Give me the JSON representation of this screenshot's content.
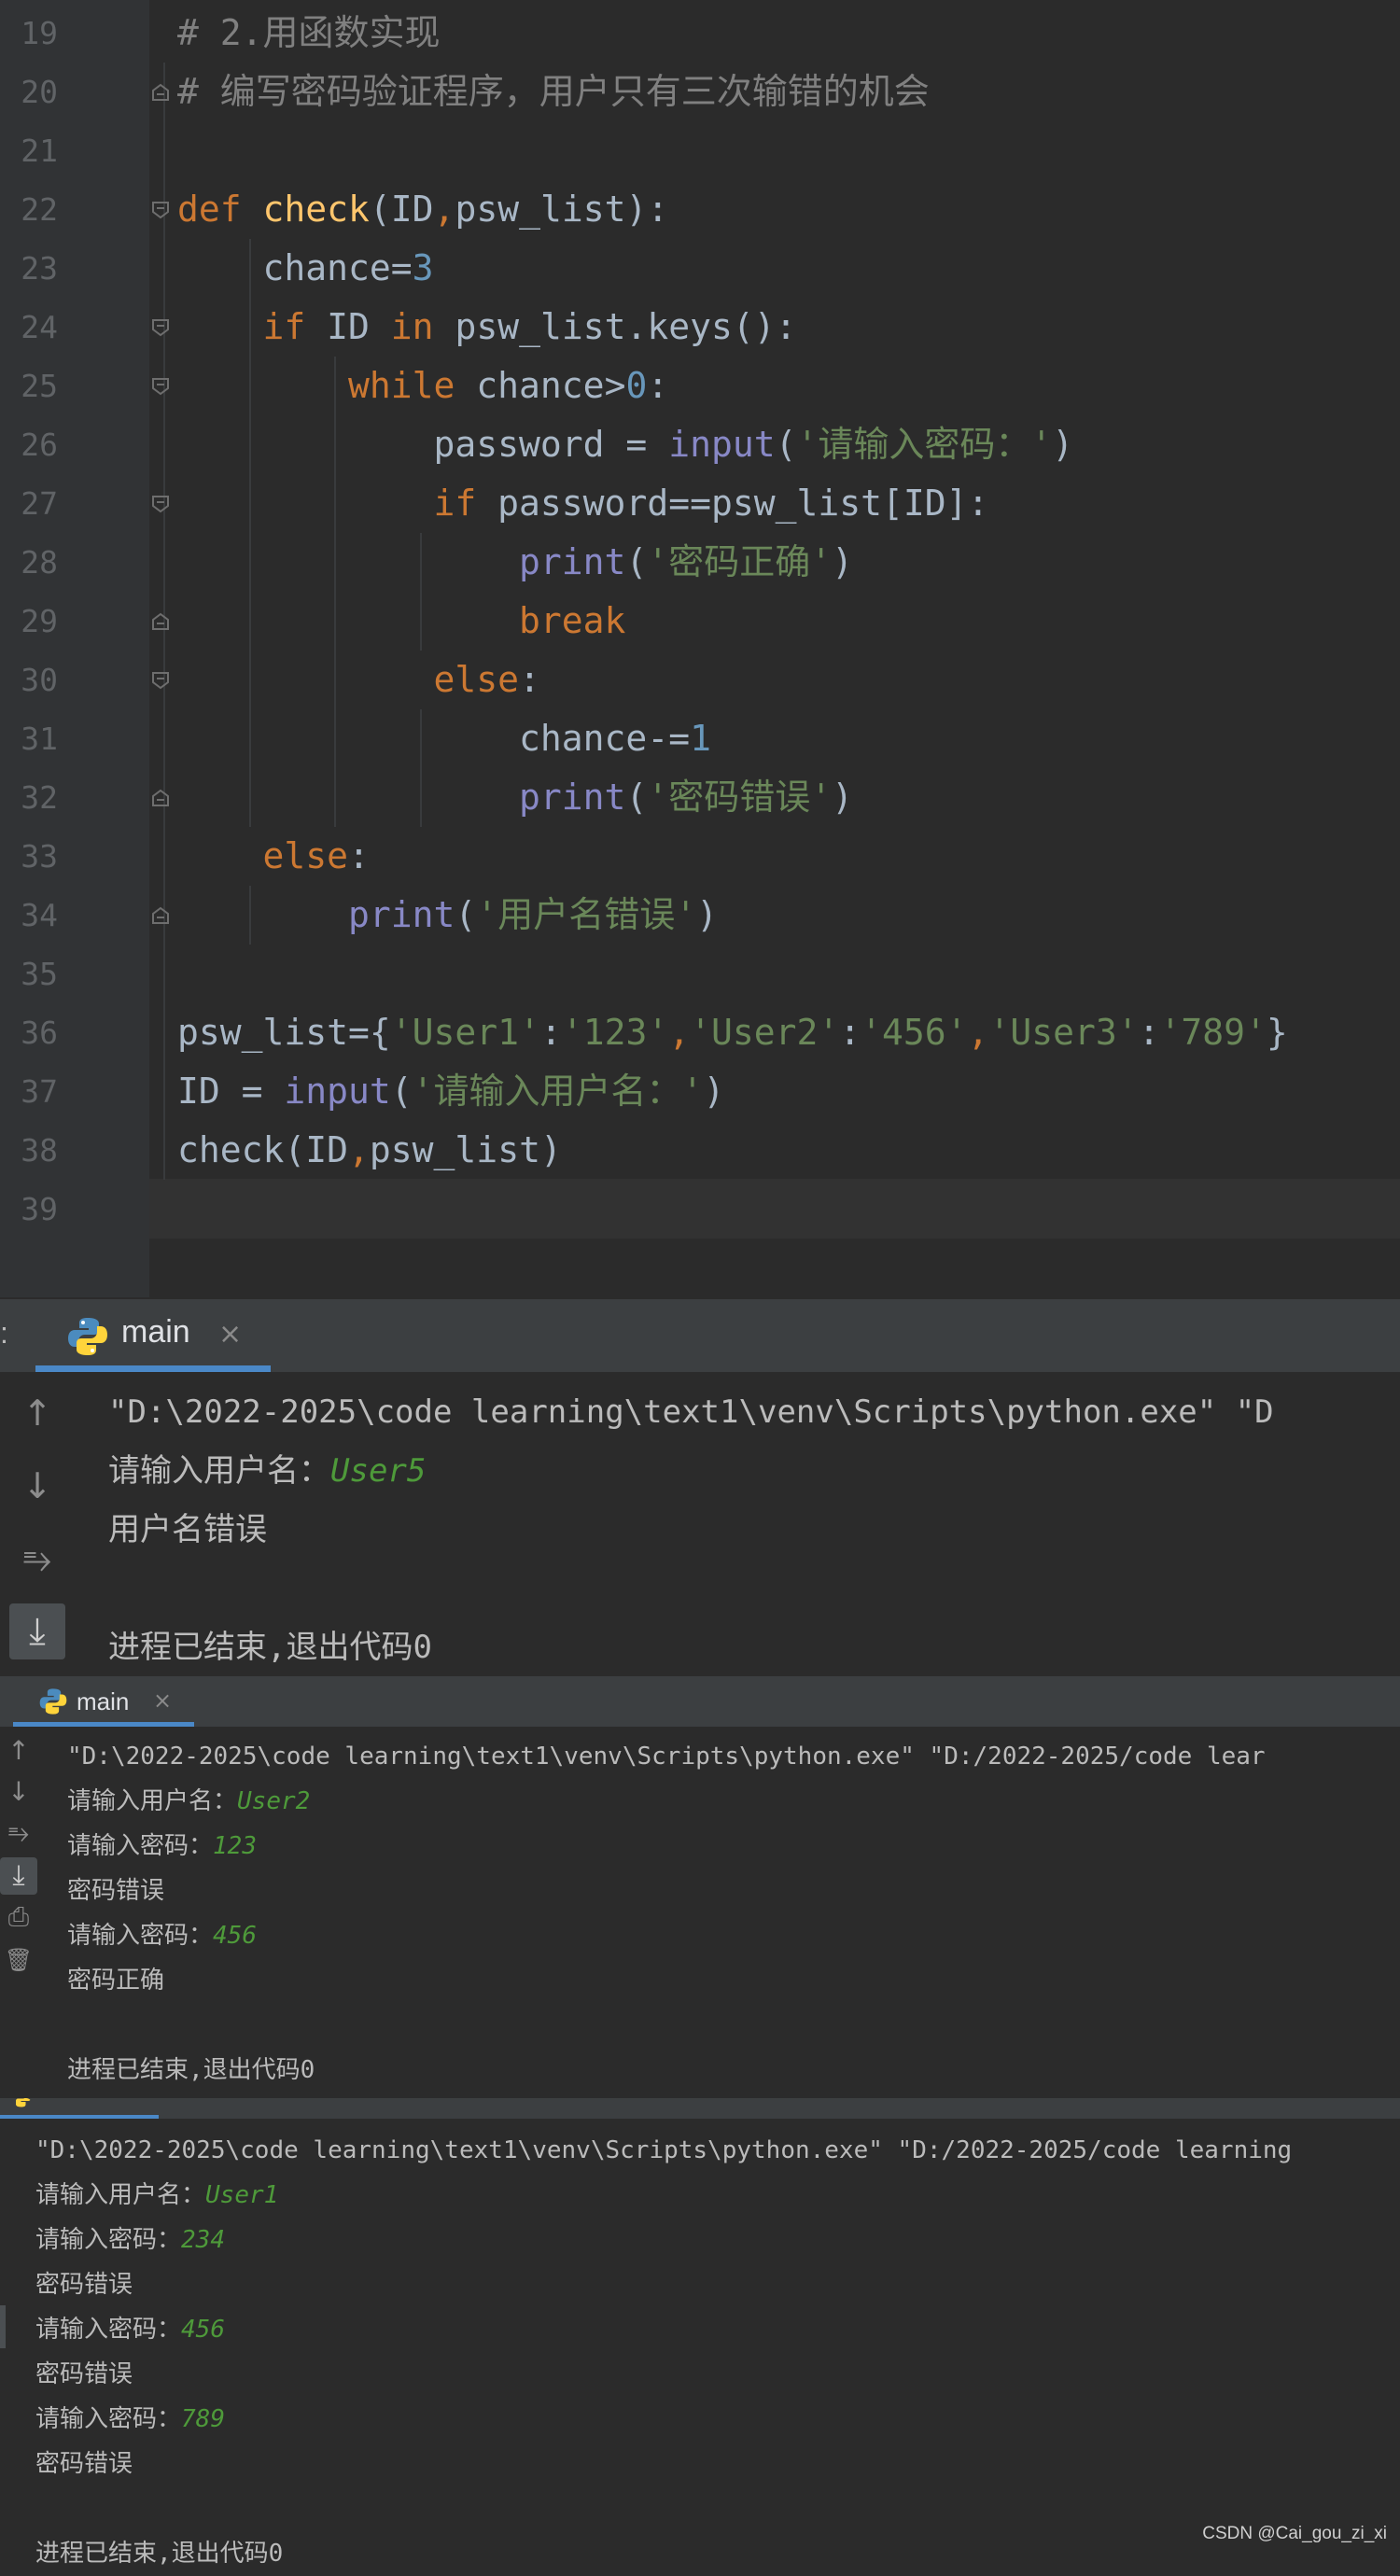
{
  "editor": {
    "lines": [
      {
        "n": "19",
        "tokens": [
          {
            "c": "cm",
            "t": "# 2.用函数实现"
          }
        ]
      },
      {
        "n": "20",
        "tokens": [
          {
            "c": "cm",
            "t": "# 编写密码验证程序，用户只有三次输错的机会"
          }
        ]
      },
      {
        "n": "21",
        "tokens": []
      },
      {
        "n": "22",
        "tokens": [
          {
            "c": "kw",
            "t": "def "
          },
          {
            "c": "fn",
            "t": "check"
          },
          {
            "c": "",
            "t": "(ID"
          },
          {
            "c": "kw",
            "t": ","
          },
          {
            "c": "",
            "t": "psw_list):"
          }
        ]
      },
      {
        "n": "23",
        "tokens": [
          {
            "c": "",
            "t": "    chance="
          },
          {
            "c": "num",
            "t": "3"
          }
        ]
      },
      {
        "n": "24",
        "tokens": [
          {
            "c": "kw",
            "t": "    if "
          },
          {
            "c": "",
            "t": "ID "
          },
          {
            "c": "kw",
            "t": "in "
          },
          {
            "c": "",
            "t": "psw_list.keys():"
          }
        ]
      },
      {
        "n": "25",
        "tokens": [
          {
            "c": "kw",
            "t": "        while "
          },
          {
            "c": "",
            "t": "chance>"
          },
          {
            "c": "num",
            "t": "0"
          },
          {
            "c": "",
            "t": ":"
          }
        ]
      },
      {
        "n": "26",
        "tokens": [
          {
            "c": "",
            "t": "            password = "
          },
          {
            "c": "bi",
            "t": "input"
          },
          {
            "c": "",
            "t": "("
          },
          {
            "c": "str",
            "t": "'请输入密码：'"
          },
          {
            "c": "",
            "t": ")"
          }
        ]
      },
      {
        "n": "27",
        "tokens": [
          {
            "c": "kw",
            "t": "            if "
          },
          {
            "c": "",
            "t": "password==psw_list[ID]:"
          }
        ]
      },
      {
        "n": "28",
        "tokens": [
          {
            "c": "bi",
            "t": "                print"
          },
          {
            "c": "",
            "t": "("
          },
          {
            "c": "str",
            "t": "'密码正确'"
          },
          {
            "c": "",
            "t": ")"
          }
        ]
      },
      {
        "n": "29",
        "tokens": [
          {
            "c": "kw",
            "t": "                break"
          }
        ]
      },
      {
        "n": "30",
        "tokens": [
          {
            "c": "kw",
            "t": "            else"
          },
          {
            "c": "",
            "t": ":"
          }
        ]
      },
      {
        "n": "31",
        "tokens": [
          {
            "c": "",
            "t": "                chance-="
          },
          {
            "c": "num",
            "t": "1"
          }
        ]
      },
      {
        "n": "32",
        "tokens": [
          {
            "c": "bi",
            "t": "                print"
          },
          {
            "c": "",
            "t": "("
          },
          {
            "c": "str",
            "t": "'密码错误'"
          },
          {
            "c": "",
            "t": ")"
          }
        ]
      },
      {
        "n": "33",
        "tokens": [
          {
            "c": "kw",
            "t": "    else"
          },
          {
            "c": "",
            "t": ":"
          }
        ]
      },
      {
        "n": "34",
        "tokens": [
          {
            "c": "bi",
            "t": "        print"
          },
          {
            "c": "",
            "t": "("
          },
          {
            "c": "str",
            "t": "'用户名错误'"
          },
          {
            "c": "",
            "t": ")"
          }
        ]
      },
      {
        "n": "35",
        "tokens": []
      },
      {
        "n": "36",
        "tokens": [
          {
            "c": "",
            "t": "psw_list={"
          },
          {
            "c": "str",
            "t": "'User1'"
          },
          {
            "c": "",
            "t": ":"
          },
          {
            "c": "str",
            "t": "'123'"
          },
          {
            "c": "kw",
            "t": ","
          },
          {
            "c": "str",
            "t": "'User2'"
          },
          {
            "c": "",
            "t": ":"
          },
          {
            "c": "str",
            "t": "'456'"
          },
          {
            "c": "kw",
            "t": ","
          },
          {
            "c": "str",
            "t": "'User3'"
          },
          {
            "c": "",
            "t": ":"
          },
          {
            "c": "str",
            "t": "'789'"
          },
          {
            "c": "",
            "t": "}"
          }
        ]
      },
      {
        "n": "37",
        "tokens": [
          {
            "c": "",
            "t": "ID = "
          },
          {
            "c": "bi",
            "t": "input"
          },
          {
            "c": "",
            "t": "("
          },
          {
            "c": "str",
            "t": "'请输入用户名：'"
          },
          {
            "c": "",
            "t": ")"
          }
        ]
      },
      {
        "n": "38",
        "tokens": [
          {
            "c": "",
            "t": "check(ID"
          },
          {
            "c": "kw",
            "t": ","
          },
          {
            "c": "",
            "t": "psw_list)"
          }
        ]
      },
      {
        "n": "39",
        "tokens": []
      }
    ]
  },
  "run1": {
    "tab_label": "main",
    "lines": [
      [
        {
          "t": "\"D:\\2022-2025\\code learning\\text1\\venv\\Scripts\\python.exe\" \"D"
        }
      ],
      [
        {
          "t": "请输入用户名："
        },
        {
          "c": "uin",
          "t": "User5"
        }
      ],
      [
        {
          "t": "用户名错误"
        }
      ],
      [
        {
          "t": ""
        }
      ],
      [
        {
          "t": "进程已结束,退出代码0"
        }
      ]
    ]
  },
  "run2": {
    "tab_label": "main",
    "lines": [
      [
        {
          "t": "\"D:\\2022-2025\\code learning\\text1\\venv\\Scripts\\python.exe\" \"D:/2022-2025/code lear"
        }
      ],
      [
        {
          "t": "请输入用户名："
        },
        {
          "c": "uin",
          "t": "User2"
        }
      ],
      [
        {
          "t": "请输入密码："
        },
        {
          "c": "uin",
          "t": "123"
        }
      ],
      [
        {
          "t": "密码错误"
        }
      ],
      [
        {
          "t": "请输入密码："
        },
        {
          "c": "uin",
          "t": "456"
        }
      ],
      [
        {
          "t": "密码正确"
        }
      ],
      [
        {
          "t": ""
        }
      ],
      [
        {
          "t": "进程已结束,退出代码0"
        }
      ]
    ]
  },
  "run3": {
    "lines": [
      [
        {
          "t": "\"D:\\2022-2025\\code learning\\text1\\venv\\Scripts\\python.exe\" \"D:/2022-2025/code learning"
        }
      ],
      [
        {
          "t": "请输入用户名："
        },
        {
          "c": "uin",
          "t": "User1"
        }
      ],
      [
        {
          "t": "请输入密码："
        },
        {
          "c": "uin",
          "t": "234"
        }
      ],
      [
        {
          "t": "密码错误"
        }
      ],
      [
        {
          "t": "请输入密码："
        },
        {
          "c": "uin",
          "t": "456"
        }
      ],
      [
        {
          "t": "密码错误"
        }
      ],
      [
        {
          "t": "请输入密码："
        },
        {
          "c": "uin",
          "t": "789"
        }
      ],
      [
        {
          "t": "密码错误"
        }
      ],
      [
        {
          "t": ""
        }
      ],
      [
        {
          "t": "进程已结束,退出代码0"
        }
      ]
    ]
  },
  "watermark": "CSDN @Cai_gou_zi_xi",
  "icons": {
    "up": "↑",
    "down": "↓",
    "wrap": "⥱",
    "scroll_end": "⤓",
    "print": "⎙",
    "trash": "🗑"
  },
  "colors": {
    "keyword": "#cc7832",
    "function": "#ffc66d",
    "builtin": "#8888c6",
    "number": "#6897bb",
    "string": "#6a8759",
    "comment": "#808080",
    "user_input": "#4e9a3a"
  }
}
